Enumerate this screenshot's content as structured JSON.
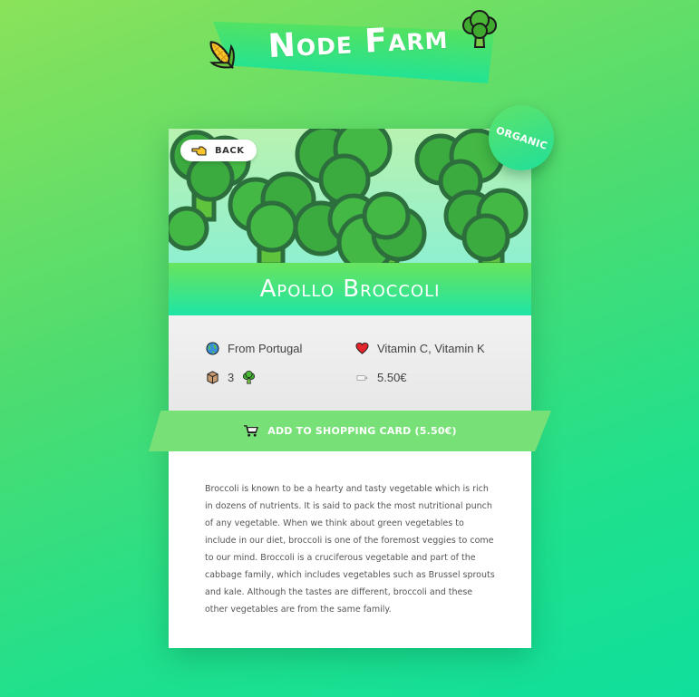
{
  "header": {
    "title": "Node Farm",
    "left_icon": "corn-icon",
    "right_icon": "broccoli-icon"
  },
  "product": {
    "back_label": "BACK",
    "badge": "ORGANIC",
    "name": "Apollo Broccoli",
    "origin": "From Portugal",
    "nutrients": "Vitamin C, Vitamin K",
    "quantity": "3",
    "price": "5.50€",
    "add_to_cart_label": "ADD TO SHOPPING CARD (5.50€)",
    "description": "Broccoli is known to be a hearty and tasty vegetable which is rich in dozens of nutrients. It is said to pack the most nutritional punch of any vegetable. When we think about green vegetables to include in our diet, broccoli is one of the foremost veggies to come to our mind. Broccoli is a cruciferous vegetable and part of the cabbage family, which includes vegetables such as Brussel sprouts and kale. Although the tastes are different, broccoli and these other vegetables are from the same family."
  },
  "icons": {
    "back": "pointing-hand-icon",
    "origin": "globe-icon",
    "nutrients": "heart-icon",
    "quantity": "box-icon",
    "quantity_unit": "broccoli-icon",
    "price": "price-tag-icon",
    "cart": "shopping-cart-icon"
  },
  "colors": {
    "background_start": "#8be25a",
    "background_end": "#10df9c",
    "accent": "#77e077",
    "title_bar_start": "#68e45e",
    "title_bar_end": "#1ee5a6"
  }
}
